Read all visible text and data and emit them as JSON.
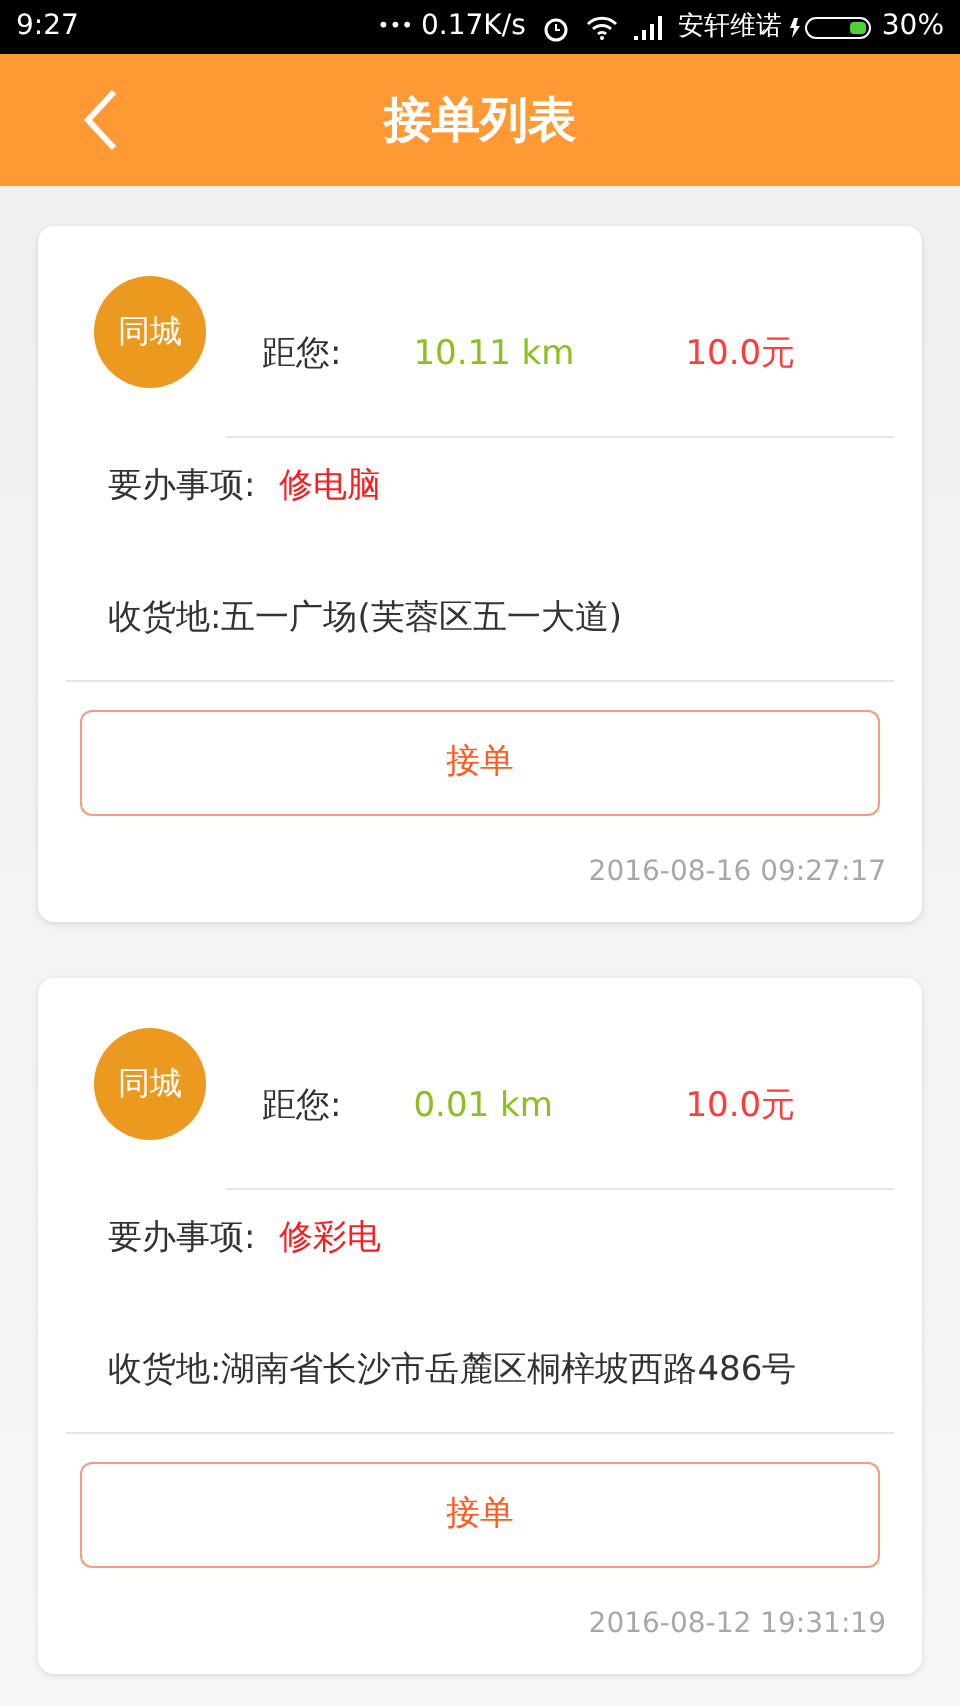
{
  "status_bar": {
    "time": "9:27",
    "dots": "•••",
    "speed": "0.17K/s",
    "carrier": "安轩维诺",
    "battery": "30%"
  },
  "header": {
    "title": "接单列表"
  },
  "orders": [
    {
      "badge": "同城",
      "distance_label": "距您:",
      "distance": "10.11 km",
      "price": "10.0元",
      "task_label": "要办事项:",
      "task": "修电脑",
      "address": "收货地:五一广场(芙蓉区五一大道)",
      "button": "接单",
      "timestamp": "2016-08-16 09:27:17"
    },
    {
      "badge": "同城",
      "distance_label": "距您:",
      "distance": "0.01 km",
      "price": "10.0元",
      "task_label": "要办事项:",
      "task": "修彩电",
      "address": "收货地:湖南省长沙市岳麓区桐梓坡西路486号",
      "button": "接单",
      "timestamp": "2016-08-12 19:31:19"
    }
  ]
}
